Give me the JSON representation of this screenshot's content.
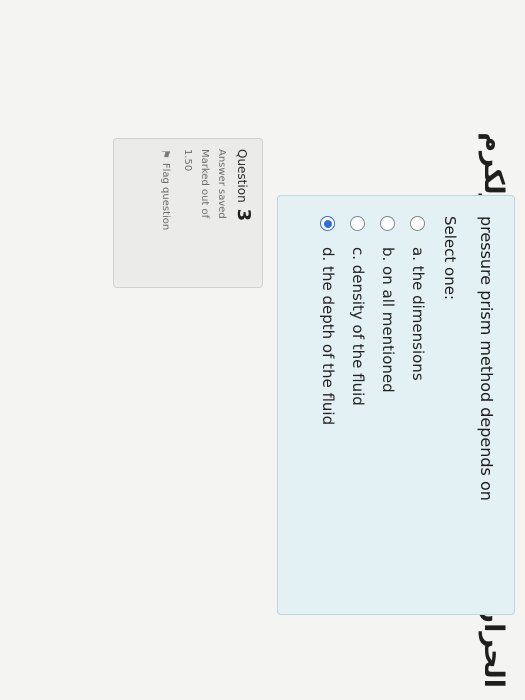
{
  "course_title": "الحراري وميكانيكا الموائع نظري - طولكرم",
  "question_info": {
    "label": "Question",
    "number": "3",
    "state": "Answer saved",
    "marked_label": "Marked out of",
    "marked_value": "1.50",
    "flag_label": "Flag question"
  },
  "question": {
    "text": "pressure prism method depends on",
    "prompt": "Select one:",
    "options": [
      {
        "label": "a. the dimensions",
        "selected": false
      },
      {
        "label": "b. on all mentioned",
        "selected": false
      },
      {
        "label": "c. density of the fluid",
        "selected": false
      },
      {
        "label": "d. the depth of the fluid",
        "selected": true
      }
    ]
  }
}
